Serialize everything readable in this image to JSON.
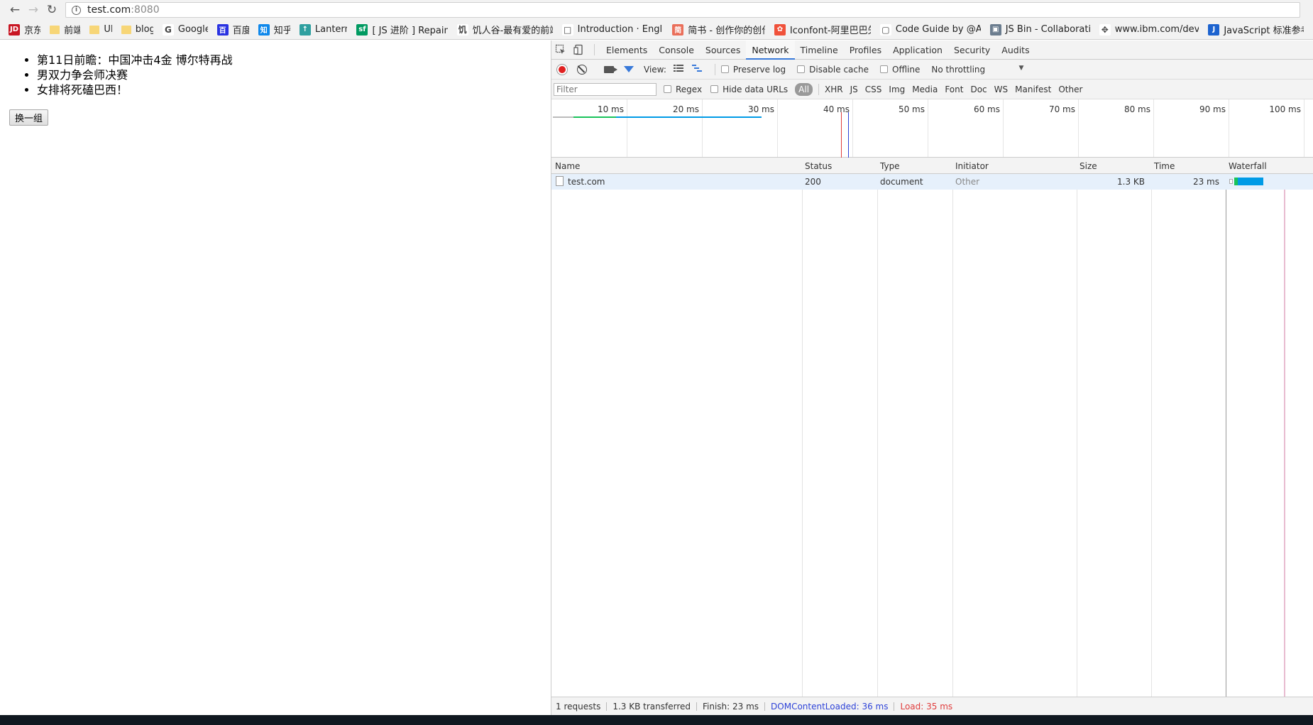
{
  "browser": {
    "url_host": "test.com",
    "url_port": ":8080",
    "bookmarks": [
      {
        "label": "京东",
        "icon": "jd-icon",
        "color": "#c81623",
        "glyph": "JD"
      },
      {
        "label": "前端",
        "icon": "folder-icon",
        "color": "#f7d677",
        "glyph": ""
      },
      {
        "label": "UI",
        "icon": "folder-icon",
        "color": "#f7d677",
        "glyph": ""
      },
      {
        "label": "blog",
        "icon": "folder-icon",
        "color": "#f7d677",
        "glyph": ""
      },
      {
        "label": "Google",
        "icon": "google-icon",
        "color": "#ffffff",
        "glyph": "G"
      },
      {
        "label": "百度",
        "icon": "baidu-icon",
        "color": "#2932e1",
        "glyph": "百"
      },
      {
        "label": "知乎",
        "icon": "zhihu-icon",
        "color": "#0f88eb",
        "glyph": "知"
      },
      {
        "label": "Lantern",
        "icon": "lantern-icon",
        "color": "#2fa0a0",
        "glyph": "↑"
      },
      {
        "label": "[ JS 进阶 ] Repaint",
        "icon": "segmentfault-icon",
        "color": "#009a61",
        "glyph": "sf"
      },
      {
        "label": "饥人谷-最有爱的前端",
        "icon": "jirengu-icon",
        "color": "#ffffff",
        "glyph": "饥"
      },
      {
        "label": "Introduction · Englis",
        "icon": "book-icon",
        "color": "#ffffff",
        "glyph": "□"
      },
      {
        "label": "简书 - 创作你的创作",
        "icon": "jianshu-icon",
        "color": "#ea6f5a",
        "glyph": "简"
      },
      {
        "label": "Iconfont-阿里巴巴矢",
        "icon": "iconfont-icon",
        "color": "#f0513a",
        "glyph": "✿"
      },
      {
        "label": "Code Guide by @All",
        "icon": "page-icon",
        "color": "#ffffff",
        "glyph": "▢"
      },
      {
        "label": "JS Bin - Collaborativ",
        "icon": "jsbin-icon",
        "color": "#6b7d8f",
        "glyph": "▣"
      },
      {
        "label": "www.ibm.com/deve",
        "icon": "ibm-icon",
        "color": "#ffffff",
        "glyph": "✥"
      },
      {
        "label": "JavaScript 标准参考",
        "icon": "js-ref-icon",
        "color": "#1d63cf",
        "glyph": "J"
      }
    ]
  },
  "page": {
    "news_items": [
      "第11日前瞻：中国冲击4金 博尔特再战",
      "男双力争会师决赛",
      "女排将死磕巴西！"
    ],
    "swap_button": "换一组"
  },
  "devtools": {
    "tabs": [
      "Elements",
      "Console",
      "Sources",
      "Network",
      "Timeline",
      "Profiles",
      "Application",
      "Security",
      "Audits"
    ],
    "active_tab": "Network",
    "toolbar": {
      "view_label": "View:",
      "preserve_log": "Preserve log",
      "disable_cache": "Disable cache",
      "offline": "Offline",
      "throttling": "No throttling"
    },
    "filter": {
      "placeholder": "Filter",
      "regex": "Regex",
      "hide_data_urls": "Hide data URLs",
      "types": [
        "All",
        "XHR",
        "JS",
        "CSS",
        "Img",
        "Media",
        "Font",
        "Doc",
        "WS",
        "Manifest",
        "Other"
      ]
    },
    "overview_ticks": [
      "10 ms",
      "20 ms",
      "30 ms",
      "40 ms",
      "50 ms",
      "60 ms",
      "70 ms",
      "80 ms",
      "90 ms",
      "100 ms"
    ],
    "columns": [
      "Name",
      "Status",
      "Type",
      "Initiator",
      "Size",
      "Time",
      "Waterfall"
    ],
    "rows": [
      {
        "name": "test.com",
        "status": "200",
        "type": "document",
        "initiator": "Other",
        "size": "1.3 KB",
        "time": "23 ms"
      }
    ],
    "status_bar": {
      "requests": "1 requests",
      "transferred": "1.3 KB transferred",
      "finish": "Finish: 23 ms",
      "dom_content_loaded": "DOMContentLoaded: 36 ms",
      "load": "Load: 35 ms"
    },
    "colors": {
      "accent": "#3879d9",
      "dcl": "#2e43d8",
      "load": "#e03c3c",
      "waterfall_bar": "#009be6",
      "waterfall_wait": "#19c35a"
    }
  }
}
